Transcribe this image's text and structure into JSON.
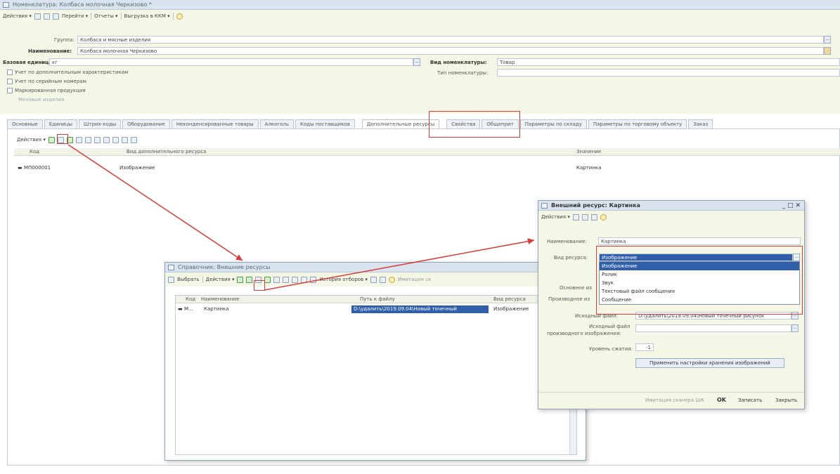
{
  "main": {
    "title": "Номенклатура: Колбаса молочная Черкизово *",
    "toolbar": {
      "actions": "Действия ▾",
      "goto": "Перейти ▾",
      "reports": "Отчеты ▾",
      "export": "Выгрузка в ККМ ▾"
    },
    "fields": {
      "group_label": "Группа:",
      "group_value": "Колбаса и мясные изделия",
      "name_label": "Наименование:",
      "name_value": "Колбаса молочная Черкизово",
      "base_unit_label": "Базовая единица:",
      "base_unit_value": "кг",
      "nom_type_label": "Вид номенклатуры:",
      "nom_type_value": "Товар",
      "nom_kind_label": "Тип номенклатуры:",
      "nom_kind_value": ""
    },
    "checks": {
      "extra_chars": "Учет по дополнительным характеристикам",
      "serials": "Учет по серийным номерам",
      "marked": "Маркированная продукция",
      "product_type": "Меховые изделия"
    },
    "tabs": [
      "Основные",
      "Единицы",
      "Штрих-коды",
      "Оборудование",
      "Неконденсированные товары",
      "Алкоголь",
      "Коды поставщиков",
      "Дополнительные ресурсы",
      "Свойства",
      "Общеприт",
      "Параметры по складу",
      "Параметры по торговому объекту",
      "Заказ"
    ],
    "active_tab_index": 7,
    "grid": {
      "actions": "Действия ▾",
      "col_code": "Код",
      "col_kind": "Вид дополнительного ресурса",
      "col_value": "Значение",
      "rows": [
        {
          "code": "МП000001",
          "kind": "Изображение",
          "value": "Картинка"
        }
      ]
    }
  },
  "catalog": {
    "title": "Справочник: Внешние ресурсы",
    "toolbar": {
      "select": "Выбрать",
      "actions": "Действия ▾",
      "history": "История отборов ▾",
      "simulation": "Имитация ск"
    },
    "grid": {
      "col_code": "Код",
      "col_name": "Наименование",
      "col_path": "Путь к файлу",
      "col_kind": "Вид ресурса",
      "rows": [
        {
          "code": "М...",
          "name": "Картинка",
          "path": "D:\\удалить\\2019.09.04\\Новый точечный",
          "kind": "Изображение"
        }
      ]
    }
  },
  "resource": {
    "title": "Внешний ресурс: Картинка",
    "controls": "_ □ ✕",
    "toolbar": {
      "actions": "Действия ▾"
    },
    "fields": {
      "name_label": "Наименование:",
      "name_value": "Картинка",
      "kind_label": "Вид ресурса:",
      "kind_value": "Изображение",
      "main_label": "Основное из",
      "derived_label": "Производное из",
      "source_label": "Исходный файл:",
      "source_value": "D:\\удалить\\2019.09.04\\Новый точечный рисунок",
      "derived_source_label1": "Исходный файл",
      "derived_source_label2": "производного изображения:",
      "derived_source_value": "",
      "compress_label": "Уровень сжатия:",
      "compress_value": "-1",
      "apply_button": "Применить настройки хранения изображений"
    },
    "dropdown": [
      "Изображение",
      "Ролик",
      "Звук",
      "Текстовый файл сообщения",
      "Сообщение"
    ],
    "dropdown_selected_index": 0,
    "footer": {
      "simulation": "Имитация сканера ШК",
      "ok": "OK",
      "save": "Записать",
      "close": "Закрыть"
    }
  },
  "colors": {
    "annotation": "#d93a3a",
    "selection": "#2f5fa8",
    "panel": "#f5f7e6"
  }
}
